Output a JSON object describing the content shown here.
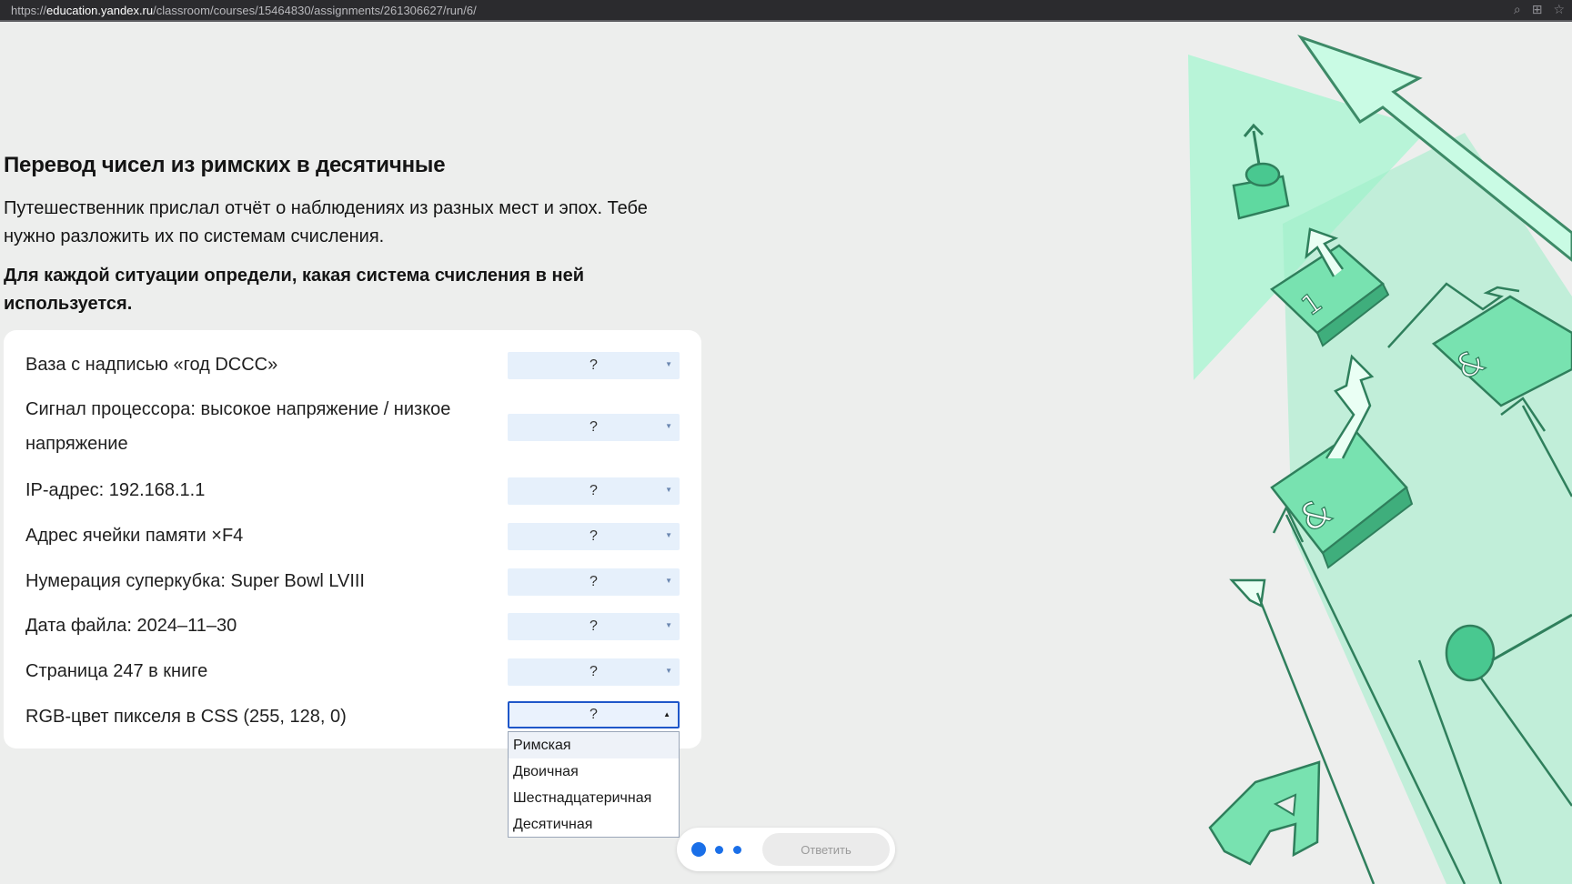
{
  "browser": {
    "url_prefix": "https://",
    "url_host": "education.yandex.ru",
    "url_path": "/classroom/courses/15464830/assignments/261306627/run/6/"
  },
  "task": {
    "title": "Перевод чисел из римских в десятичные",
    "intro": "Путешественник прислал отчёт о наблюдениях из разных мест и эпох. Тебе нужно разложить их по системам счисления.",
    "instruction": "Для каждой ситуации определи, какая система счисления в ней используется."
  },
  "rows": [
    {
      "label": "Ваза с надписью «год DCCC»",
      "value": "?"
    },
    {
      "label": "Сигнал процессора: высокое напряжение / низкое напряжение",
      "value": "?"
    },
    {
      "label": "IP-адрес: 192.168.1.1",
      "value": "?"
    },
    {
      "label": "Адрес ячейки памяти ×F4",
      "value": "?"
    },
    {
      "label": "Нумерация суперкубка: Super Bowl LVIII",
      "value": "?"
    },
    {
      "label": "Дата файла: 2024–11–30",
      "value": "?"
    },
    {
      "label": "Страница 247 в книге",
      "value": "?"
    },
    {
      "label": "RGB-цвет пикселя в CSS (255, 128, 0)",
      "value": "?"
    }
  ],
  "dropdown": {
    "options": [
      "Римская",
      "Двоичная",
      "Шестнадцатеричная",
      "Десятичная"
    ],
    "highlighted_index": 0
  },
  "pager": {
    "answer_label": "Ответить",
    "accent_color": "#1a6fe8"
  },
  "icons": {
    "toolbar": [
      "zoom-icon",
      "apps-icon",
      "bookmark-star-icon"
    ]
  }
}
